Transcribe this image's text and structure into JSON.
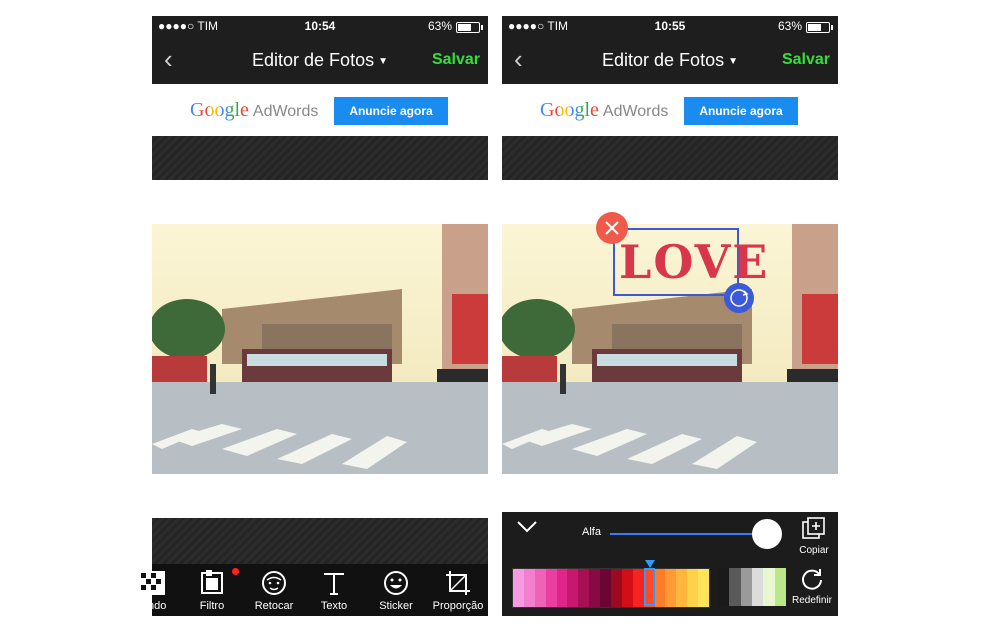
{
  "status_left": {
    "carrier": "●●●●○ TIM",
    "time": "10:54",
    "battery": "63%"
  },
  "status_right": {
    "carrier": "●●●●○ TIM",
    "time": "10:55",
    "battery": "63%"
  },
  "battery_level": 0.63,
  "nav": {
    "back": "‹",
    "title": "Editor de Fotos",
    "caret": "▼",
    "save": "Salvar"
  },
  "ad": {
    "google": "Google",
    "adwords": "AdWords",
    "cta": "Anuncie agora"
  },
  "sticker": {
    "text": "LOVE"
  },
  "toolbar": {
    "items": [
      {
        "label": "ndo",
        "icon": "pattern-icon"
      },
      {
        "label": "Filtro",
        "icon": "filter-icon"
      },
      {
        "label": "Retocar",
        "icon": "face-icon"
      },
      {
        "label": "Texto",
        "icon": "text-icon"
      },
      {
        "label": "Sticker",
        "icon": "smiley-icon"
      },
      {
        "label": "Proporção",
        "icon": "crop-icon"
      }
    ]
  },
  "editor": {
    "alfa_label": "Alfa",
    "alfa_value": 1.0,
    "copy_label": "Copiar",
    "reset_label": "Redefinir",
    "palette": [
      "#f59be4",
      "#f280cf",
      "#ee63b8",
      "#ea3fa0",
      "#e0248a",
      "#c8176e",
      "#a81056",
      "#880a44",
      "#6b0634",
      "#9b0a1e",
      "#d40e16",
      "#f5241e",
      "#ff4a26",
      "#ff7a2a",
      "#ff9a35",
      "#ffb53e",
      "#ffd04a",
      "#ffe45a"
    ],
    "palette_gray": [
      "#1a1a1a",
      "#5a5a5a",
      "#9a9a9a",
      "#dcdcdc",
      "#e8f7cf",
      "#b9e78a"
    ],
    "selected_color": "#f5241e"
  },
  "colors": {
    "save": "#35e03a",
    "cta": "#1a8cf0",
    "accent": "#2a9dff",
    "delete": "#f05a4a"
  }
}
